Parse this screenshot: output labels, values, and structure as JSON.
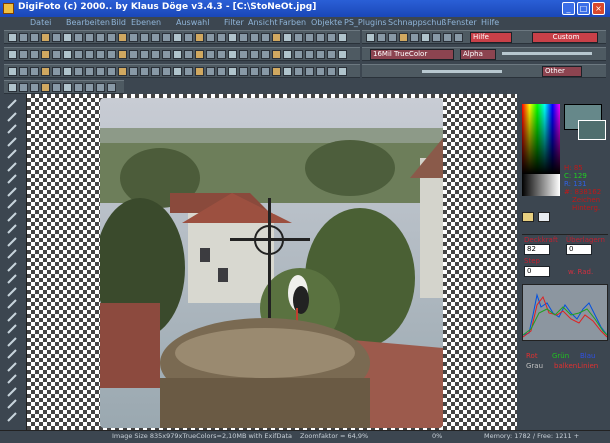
{
  "window": {
    "title": "DigiFoto (c) 2000.. by Klaus Döge v3.4.3 - [C:\\StoNeOt.jpg]"
  },
  "menu": [
    "Datei",
    "Bearbeiten",
    "Bild",
    "Ebenen",
    "Auswahl",
    "Filter",
    "Ansicht",
    "Farben",
    "Objekte",
    "PS_Plugins",
    "Schnappschuß",
    "Fenster",
    "Hilfe"
  ],
  "toolbar": {
    "zoom_label": "Hilfe",
    "color_mode": "16Mil TrueColor",
    "alpha_label": "Alpha",
    "custom_label": "Custom",
    "other_label": "Other"
  },
  "color_panel": {
    "h_value": "H: 85",
    "c_value": "C: 129",
    "r_value": "R: 131",
    "hex_value": "#: 838162",
    "option1": "Zeichen",
    "option2": "Hinterg.",
    "swatch": "#66888a"
  },
  "brush_panel": {
    "label1": "Deckkraft",
    "label2": "Überlagern",
    "value1": "82",
    "value2": "0",
    "label3": "Step",
    "value3": "0",
    "checkbox_label": "w. Rad."
  },
  "histogram_panel": {
    "cb_rot": "Rot",
    "cb_gruen": "Grün",
    "cb_blau": "Blau",
    "cb_grau": "Grau",
    "cb_balken": "balkenLinien"
  },
  "status": {
    "image_size": "Image Size 835x979xTrueColors=2,10MB with ExifData",
    "zoom": "Zoomfaktor = 64,9%",
    "percent": "0%",
    "memory": "Memory: 1782 / Free: 1211 +"
  }
}
